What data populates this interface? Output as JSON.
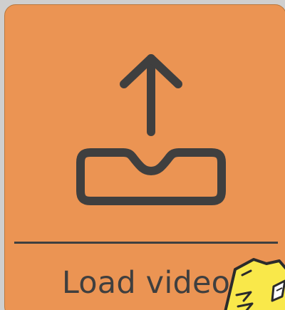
{
  "card": {
    "label": "Load video",
    "icon": "upload-tray-icon",
    "background_color": "#EB9453",
    "foreground_color": "#3F3F3F"
  },
  "mascot": {
    "icon": "yellow-cartoon-character-icon",
    "color": "#F9E84A"
  }
}
